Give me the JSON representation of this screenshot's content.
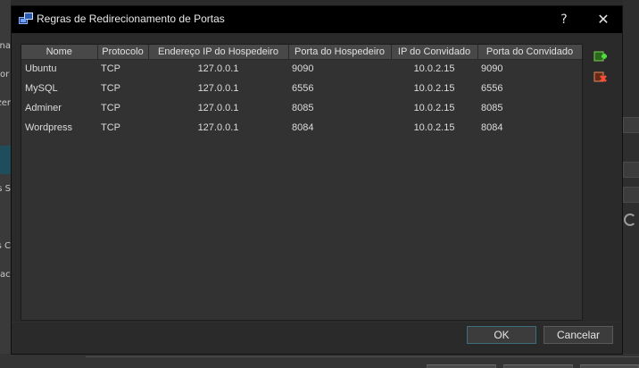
{
  "background": {
    "left_fragments": [
      "na",
      "or",
      "zer",
      "s S",
      "s C",
      "ac"
    ]
  },
  "dialog": {
    "title": "Regras de Redirecionamento de Portas",
    "help_label": "?",
    "close_label": "✕",
    "columns": [
      "Nome",
      "Protocolo",
      "Endereço IP do Hospedeiro",
      "Porta do Hospedeiro",
      "IP do Convidado",
      "Porta do Convidado"
    ],
    "rows": [
      [
        "Ubuntu",
        "TCP",
        "127.0.0.1",
        "9090",
        "10.0.2.15",
        "9090"
      ],
      [
        "MySQL",
        "TCP",
        "127.0.0.1",
        "6556",
        "10.0.2.15",
        "6556"
      ],
      [
        "Adminer",
        "TCP",
        "127.0.0.1",
        "8085",
        "10.0.2.15",
        "8085"
      ],
      [
        "Wordpress",
        "TCP",
        "127.0.0.1",
        "8084",
        "10.0.2.15",
        "8084"
      ]
    ],
    "add_rule_icon": "plus-icon",
    "remove_rule_icon": "remove-icon",
    "ok_label": "OK",
    "cancel_label": "Cancelar",
    "colors": {
      "titlebar": "#000000",
      "dialog_bg": "#2a2a2a",
      "table_bg": "#323232",
      "header_bg": "#484848",
      "add_green": "#3fbf2f",
      "remove_red": "#e04030"
    }
  }
}
